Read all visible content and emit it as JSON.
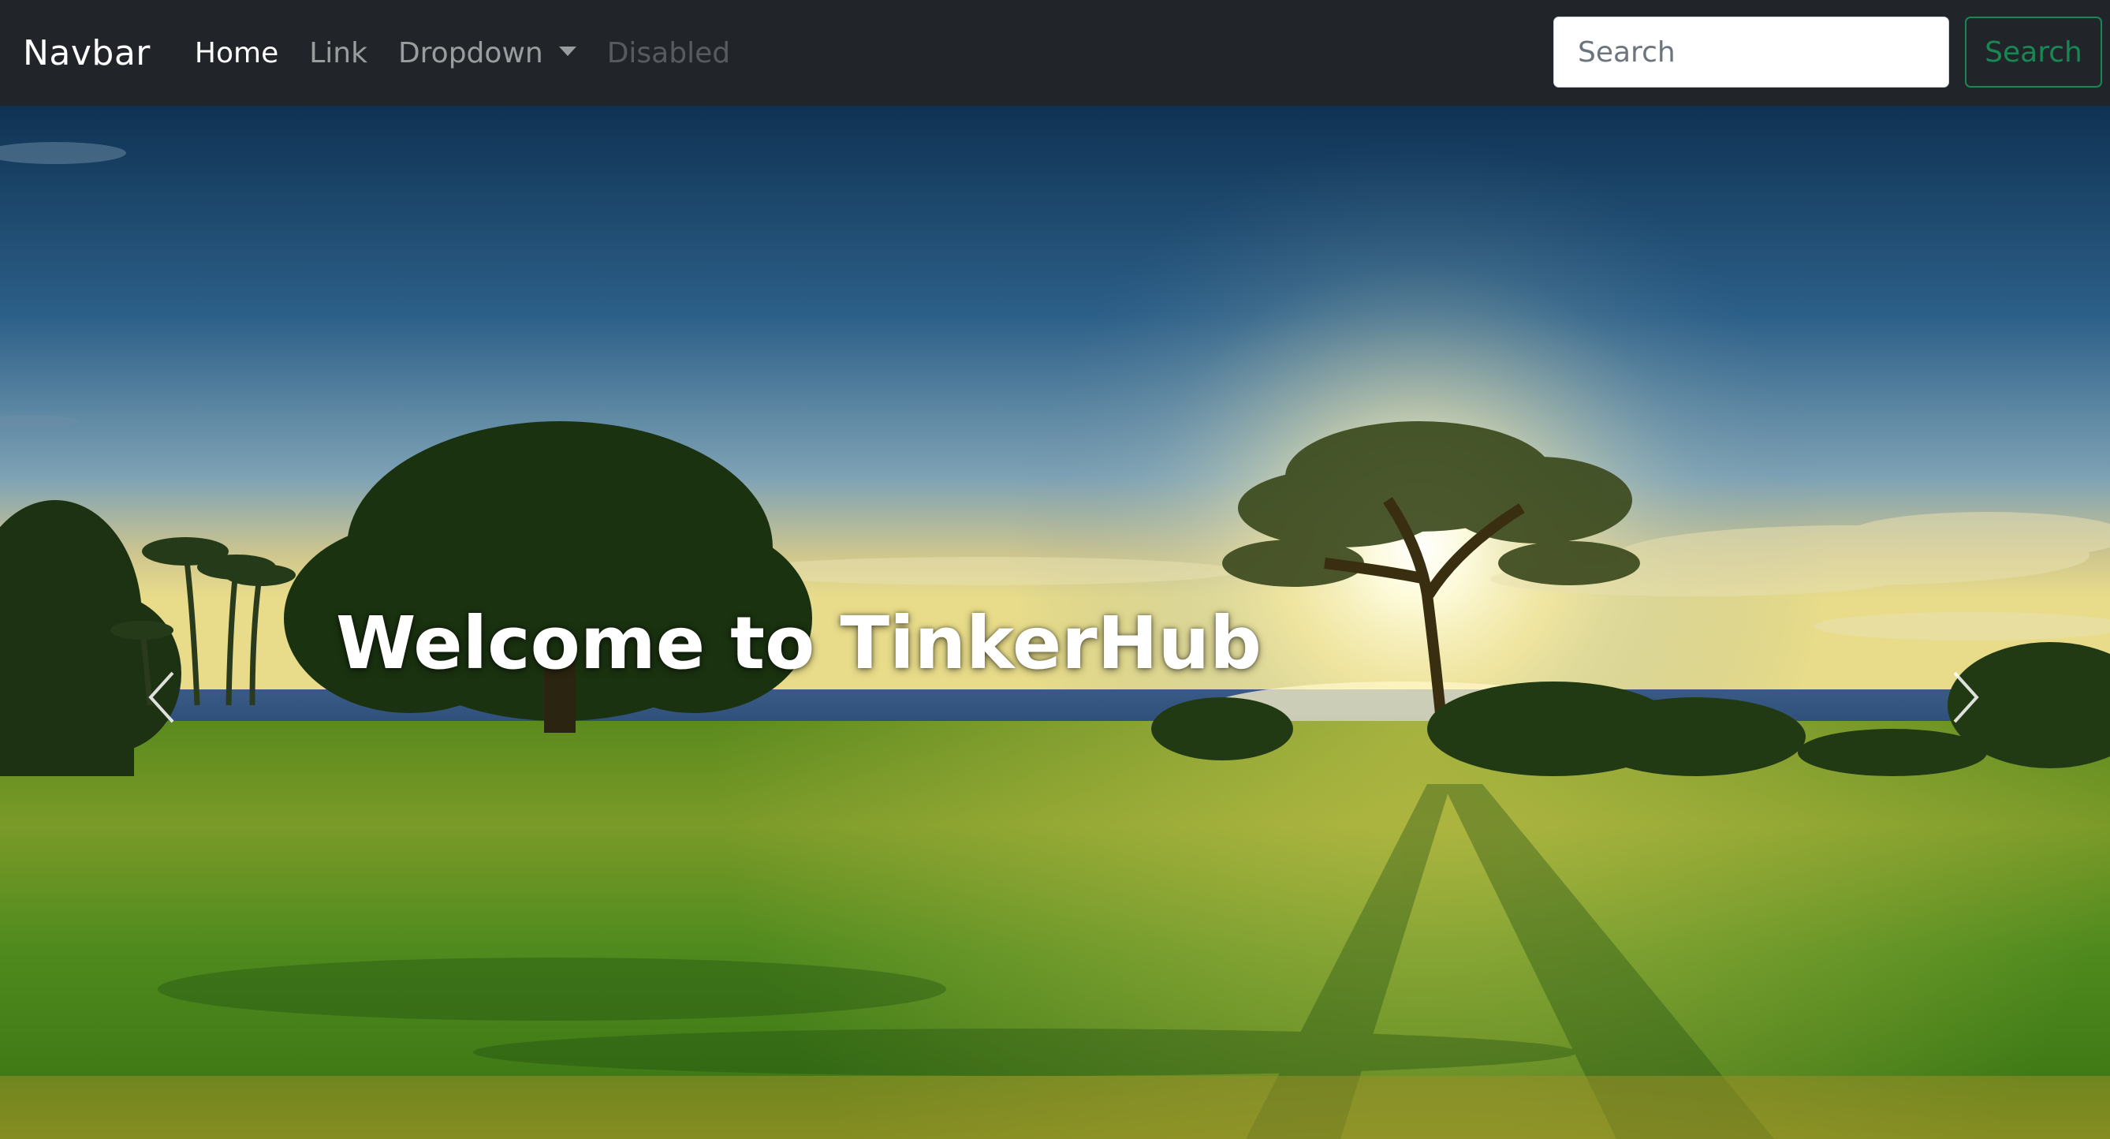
{
  "navbar": {
    "brand": "Navbar",
    "links": [
      {
        "label": "Home",
        "state": "active"
      },
      {
        "label": "Link",
        "state": "normal"
      },
      {
        "label": "Dropdown",
        "state": "dropdown"
      },
      {
        "label": "Disabled",
        "state": "disabled"
      }
    ],
    "search": {
      "placeholder": "Search",
      "button_label": "Search"
    }
  },
  "carousel": {
    "caption": "Welcome to TinkerHub",
    "prev_icon": "chevron-left-icon",
    "next_icon": "chevron-right-icon"
  },
  "colors": {
    "navbar_bg": "#212529",
    "search_button": "#198754",
    "sky_top": "#12395a",
    "grass": "#4f8a1e"
  }
}
